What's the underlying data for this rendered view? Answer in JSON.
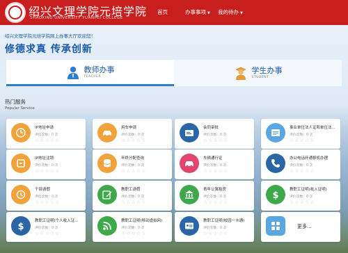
{
  "header": {
    "school_name": "绍兴文理学院元培学院",
    "school_name_en": "SHAOXING UNIVERSITY YUANPEI COLLEGE",
    "nav": [
      "首页",
      "办事事项",
      "我的待办"
    ],
    "nav_caret": "▼"
  },
  "welcome": "绍兴文理学院元培学院网上办事大厅欢迎您！",
  "motto": "修德求真 传承创新",
  "tabs": [
    {
      "cn": "教师办事",
      "en": "TEACHER"
    },
    {
      "cn": "学生办事",
      "en": "STUDENT"
    }
  ],
  "section": {
    "title": "热门服务",
    "subtitle": "Popular Service"
  },
  "colors": {
    "brand_red": "#c81f1e",
    "blue": "#3a87d4",
    "orange": "#f2a23a",
    "dark_blue": "#2a66a6",
    "sky": "#5aa6e0",
    "rose": "#e0456d",
    "green": "#3fa84a"
  },
  "star_glyphs": "☆☆☆☆☆",
  "services": [
    {
      "name": "IP地址申请",
      "count": "评价次数：0 次",
      "icon": "ip-address-icon",
      "color": "#f2a23a"
    },
    {
      "name": "用车申请",
      "count": "评价次数：0 次",
      "icon": "car-icon",
      "color": "#f2a23a"
    },
    {
      "name": "会同审批",
      "count": "评价次数：0 次",
      "icon": "card-icon",
      "color": "#2a66a6"
    },
    {
      "name": "事业单位法人证和单位法...",
      "count": "评价次数：0 次",
      "icon": "certificate-icon",
      "color": "#5aa6e0"
    },
    {
      "name": "IP地址注销",
      "count": "评价次数：0 次",
      "icon": "ip-cancel-icon",
      "color": "#f2a23a"
    },
    {
      "name": "年终分配查询",
      "count": "评价次数：0 次",
      "icon": "database-icon",
      "color": "#f2a23a"
    },
    {
      "name": "车辆通行证",
      "count": "评价次数：0 次",
      "icon": "car-pass-icon",
      "color": "#e0456d"
    },
    {
      "name": "办公电话开通移机办理",
      "count": "评价次数：0 次",
      "icon": "phone-icon",
      "color": "#2a66a6"
    },
    {
      "name": "干部请假",
      "count": "评价次数：0 次",
      "icon": "leave-icon",
      "color": "#f2a23a"
    },
    {
      "name": "教职工请假",
      "count": "评价次数：0 次",
      "icon": "edit-icon",
      "color": "#3fa84a"
    },
    {
      "name": "青年公寓租房",
      "count": "评价次数：0 次",
      "icon": "building-icon",
      "color": "#3fa84a"
    },
    {
      "name": "教职工证明(收入证明)",
      "count": "评价次数：0 次",
      "icon": "dollar-icon",
      "color": "#3fa84a"
    },
    {
      "name": "教职工证明(个人收入证...",
      "count": "评价次数：0 次",
      "icon": "dollar-icon",
      "color": "#2a66a6"
    },
    {
      "name": "教职工证明(移动虚拟网)",
      "count": "评价次数：0 次",
      "icon": "rss-icon",
      "color": "#3fa84a"
    },
    {
      "name": "教职工证明(校园一卡通)",
      "count": "评价次数：0 次",
      "icon": "id-card-icon",
      "color": "#2a66a6"
    }
  ],
  "more": {
    "label": "更多...",
    "icon": "grid-icon",
    "color": "#5aa6e0"
  }
}
